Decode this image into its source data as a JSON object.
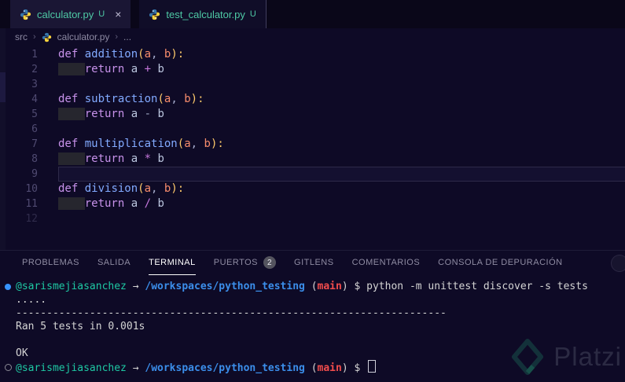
{
  "tabs": [
    {
      "label": "calculator.py",
      "git": "U",
      "close": "×",
      "active": true
    },
    {
      "label": "test_calculator.py",
      "git": "U",
      "active": false
    }
  ],
  "breadcrumb": {
    "items": [
      "src",
      "calculator.py",
      "..."
    ],
    "separator": "›"
  },
  "editor": {
    "lines": [
      {
        "num": "1",
        "tokens": [
          [
            "kw",
            "def"
          ],
          [
            "tx",
            " "
          ],
          [
            "fn",
            "addition"
          ],
          [
            "pn",
            "("
          ],
          [
            "pm",
            "a"
          ],
          [
            "cm",
            ","
          ],
          [
            "tx",
            " "
          ],
          [
            "pm",
            "b"
          ],
          [
            "pn",
            ")"
          ],
          [
            "pn",
            ":"
          ]
        ]
      },
      {
        "num": "2",
        "indent": true,
        "tokens": [
          [
            "kw",
            "return"
          ],
          [
            "tx",
            " a "
          ],
          [
            "op",
            "+"
          ],
          [
            "tx",
            " b"
          ]
        ]
      },
      {
        "num": "3",
        "tokens": []
      },
      {
        "num": "4",
        "tokens": [
          [
            "kw",
            "def"
          ],
          [
            "tx",
            " "
          ],
          [
            "fn",
            "subtraction"
          ],
          [
            "pn",
            "("
          ],
          [
            "pm",
            "a"
          ],
          [
            "cm",
            ","
          ],
          [
            "tx",
            " "
          ],
          [
            "pm",
            "b"
          ],
          [
            "pn",
            ")"
          ],
          [
            "pn",
            ":"
          ]
        ]
      },
      {
        "num": "5",
        "indent": true,
        "tokens": [
          [
            "kw",
            "return"
          ],
          [
            "tx",
            " a "
          ],
          [
            "od",
            "-"
          ],
          [
            "tx",
            " b"
          ]
        ]
      },
      {
        "num": "6",
        "tokens": []
      },
      {
        "num": "7",
        "tokens": [
          [
            "kw",
            "def"
          ],
          [
            "tx",
            " "
          ],
          [
            "fn",
            "multiplication"
          ],
          [
            "pn",
            "("
          ],
          [
            "pm",
            "a"
          ],
          [
            "cm",
            ","
          ],
          [
            "tx",
            " "
          ],
          [
            "pm",
            "b"
          ],
          [
            "pn",
            ")"
          ],
          [
            "pn",
            ":"
          ]
        ]
      },
      {
        "num": "8",
        "indent": true,
        "tokens": [
          [
            "kw",
            "return"
          ],
          [
            "tx",
            " a "
          ],
          [
            "op",
            "*"
          ],
          [
            "tx",
            " b"
          ]
        ]
      },
      {
        "num": "9",
        "current": true,
        "tokens": []
      },
      {
        "num": "10",
        "tokens": [
          [
            "kw",
            "def"
          ],
          [
            "tx",
            " "
          ],
          [
            "fn",
            "division"
          ],
          [
            "pn",
            "("
          ],
          [
            "pm",
            "a"
          ],
          [
            "cm",
            ","
          ],
          [
            "tx",
            " "
          ],
          [
            "pm",
            "b"
          ],
          [
            "pn",
            ")"
          ],
          [
            "pn",
            ":"
          ]
        ]
      },
      {
        "num": "11",
        "indent": true,
        "tokens": [
          [
            "kw",
            "return"
          ],
          [
            "tx",
            " a "
          ],
          [
            "op",
            "/"
          ],
          [
            "tx",
            " b"
          ]
        ]
      },
      {
        "num": "12",
        "dim": true,
        "tokens": []
      }
    ]
  },
  "panel": {
    "tabs": [
      {
        "label": "PROBLEMAS"
      },
      {
        "label": "SALIDA"
      },
      {
        "label": "TERMINAL",
        "active": true
      },
      {
        "label": "PUERTOS",
        "badge": "2"
      },
      {
        "label": "GITLENS"
      },
      {
        "label": "COMENTARIOS"
      },
      {
        "label": "CONSOLA DE DEPURACIÓN"
      }
    ]
  },
  "terminal": {
    "lines": [
      {
        "deco": "filled",
        "segs": [
          [
            "user",
            "@sarismejiasanchez"
          ],
          [
            "plain",
            " "
          ],
          [
            "arrow",
            "→"
          ],
          [
            "plain",
            " "
          ],
          [
            "path",
            "/workspaces/python_testing"
          ],
          [
            "plain",
            " ("
          ],
          [
            "branch",
            "main"
          ],
          [
            "plain",
            ") $ "
          ],
          [
            "cmd",
            "python -m unittest discover -s tests"
          ]
        ]
      },
      {
        "segs": [
          [
            "out",
            "....."
          ]
        ]
      },
      {
        "segs": [
          [
            "out",
            "----------------------------------------------------------------------"
          ]
        ]
      },
      {
        "segs": [
          [
            "out",
            "Ran 5 tests in 0.001s"
          ]
        ]
      },
      {
        "segs": []
      },
      {
        "segs": [
          [
            "out",
            "OK"
          ]
        ]
      },
      {
        "deco": "hollow",
        "cursor": true,
        "segs": [
          [
            "user",
            "@sarismejiasanchez"
          ],
          [
            "plain",
            " "
          ],
          [
            "arrow",
            "→"
          ],
          [
            "plain",
            " "
          ],
          [
            "path",
            "/workspaces/python_testing"
          ],
          [
            "plain",
            " ("
          ],
          [
            "branch",
            "main"
          ],
          [
            "plain",
            ") $ "
          ]
        ]
      }
    ]
  },
  "watermark": {
    "text": "Platzi"
  },
  "colors": {
    "background": "#0e0a26",
    "tabbar_background": "#0a0719",
    "file_untracked_green": "#4ec9a5",
    "keyword": "#c792ea",
    "function_name": "#82aaff",
    "punctuation_gold": "#ffcb6b",
    "parameter_orange": "#f78c6c",
    "operator_magenta": "#c678dd",
    "terminal_user_green": "#1ec9a4",
    "terminal_path_blue": "#3b8eea",
    "terminal_branch_red": "#f14c4c",
    "terminal_text": "#d4d4d4",
    "prompt_dot_blue": "#3794ff"
  }
}
